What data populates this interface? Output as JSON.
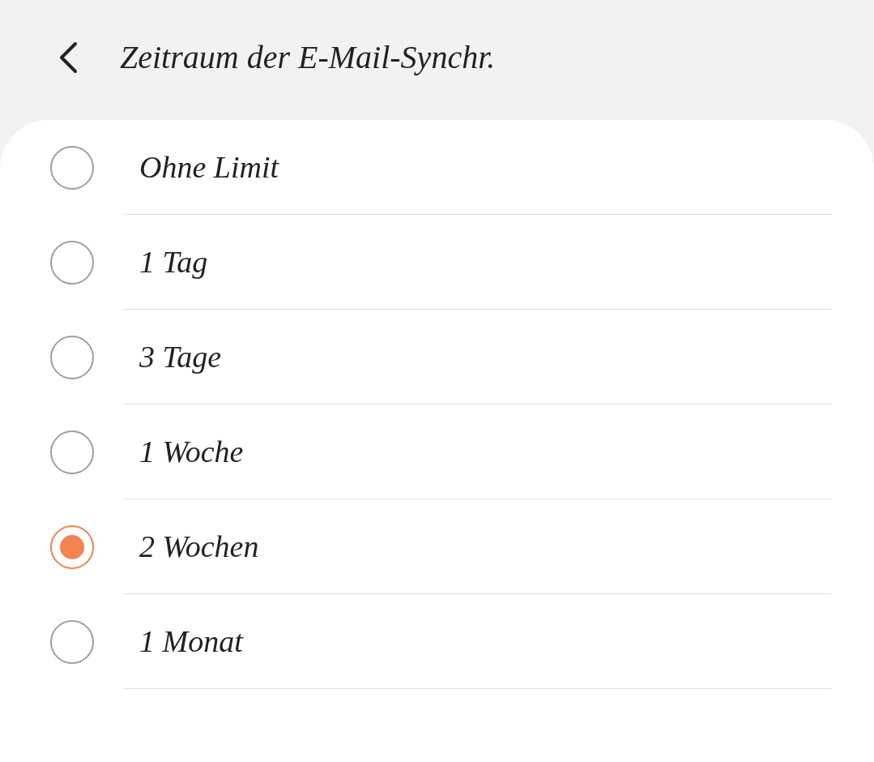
{
  "header": {
    "title": "Zeitraum der E-Mail-Synchr."
  },
  "options": [
    {
      "label": "Ohne Limit",
      "selected": false
    },
    {
      "label": "1 Tag",
      "selected": false
    },
    {
      "label": "3 Tage",
      "selected": false
    },
    {
      "label": "1 Woche",
      "selected": false
    },
    {
      "label": "2 Wochen",
      "selected": true
    },
    {
      "label": "1 Monat",
      "selected": false
    }
  ]
}
